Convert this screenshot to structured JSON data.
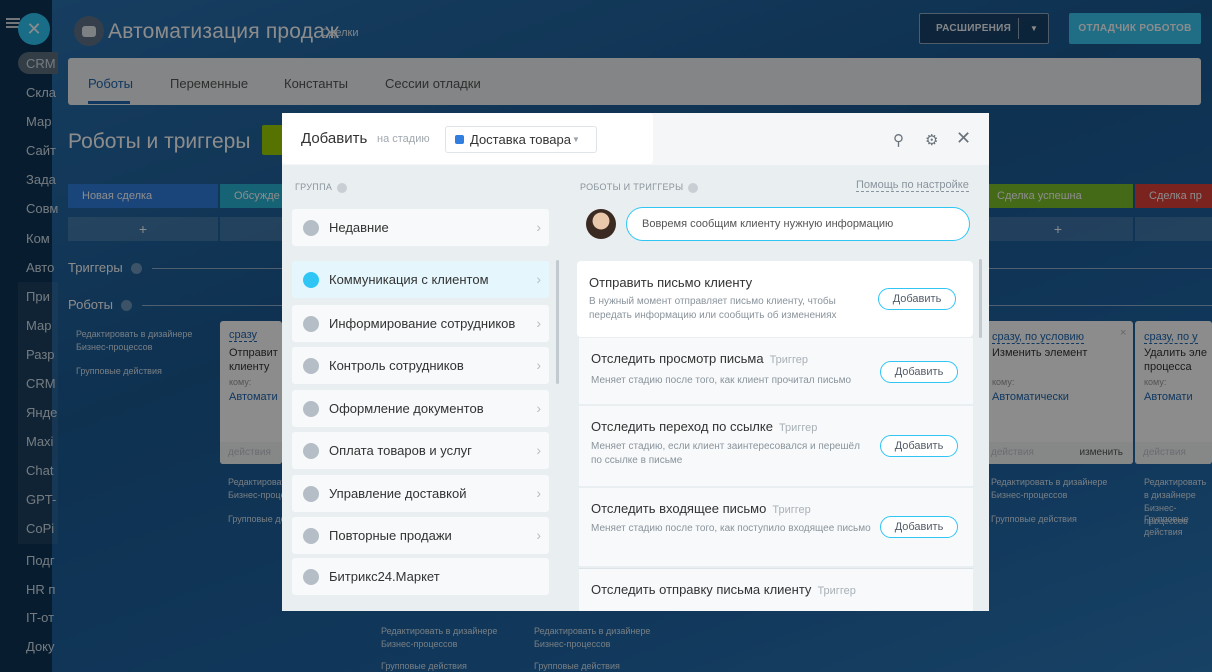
{
  "left_nav": {
    "items": [
      "CRM",
      "Скла",
      "Мар",
      "Сайт",
      "Зада",
      "Совм",
      "Ком",
      "Авто",
      "При",
      "Мар",
      "Разр",
      "CRM",
      "Янде",
      "Maxi",
      "Chat",
      "GPT-",
      "CoPi",
      "Подг",
      "HR п",
      "IT-от",
      "Доку"
    ]
  },
  "header": {
    "title": "Автоматизация продаж",
    "subtitle": "Сделки",
    "ext_button": "РАСШИРЕНИЯ",
    "debug_button": "ОТЛАДЧИК РОБОТОВ"
  },
  "tabs": [
    "Роботы",
    "Переменные",
    "Константы",
    "Сессии отладки"
  ],
  "page": {
    "title": "Роботы и триггеры",
    "triggers_label": "Триггеры",
    "robots_label": "Роботы",
    "stages": [
      "Новая сделка",
      "Обсужде",
      "Сделка успешна",
      "Сделка пр"
    ],
    "edit_link_1": "Редактировать в дизайнере",
    "edit_link_2": "Бизнес-процессов",
    "group_actions": "Групповые действия",
    "card_left": {
      "when": "сразу",
      "line1": "Отправит",
      "line2": "клиенту",
      "to": "кому:",
      "auto": "Автомати",
      "foot": "действия"
    },
    "card_r1": {
      "when": "сразу, по условию",
      "title": "Изменить элемент",
      "to": "кому:",
      "auto": "Автоматически",
      "foot": "действия",
      "edit": "изменить"
    },
    "card_r2": {
      "when": "сразу, по у",
      "line1": "Удалить эле",
      "line2": "процесса",
      "to": "кому:",
      "auto": "Автомати",
      "foot": "действия"
    },
    "bottom_edit": "Редактировать в дизайнере",
    "bottom_bp": "Бизнес-процессов",
    "bottom_group": "Групповые действия"
  },
  "dialog": {
    "title": "Добавить",
    "stage_prefix": "на стадию",
    "stage": "Доставка товара",
    "group_header": "ГРУППА",
    "list_header": "РОБОТЫ И ТРИГГЕРЫ",
    "help_link": "Помощь по настройке",
    "bubble": "Вовремя сообщим клиенту нужную информацию",
    "groups": [
      "Недавние",
      "Коммуникация с клиентом",
      "Информирование сотрудников",
      "Контроль сотрудников",
      "Оформление документов",
      "Оплата товаров и услуг",
      "Управление доставкой",
      "Повторные продажи",
      "Битрикс24.Маркет"
    ],
    "items": [
      {
        "title": "Отправить письмо клиенту",
        "trigger": "",
        "desc": "В нужный момент отправляет письмо клиенту, чтобы передать информацию или сообщить об изменениях"
      },
      {
        "title": "Отследить просмотр письма",
        "trigger": "Триггер",
        "desc": "Меняет стадию после того, как клиент прочитал письмо"
      },
      {
        "title": "Отследить переход по ссылке",
        "trigger": "Триггер",
        "desc": "Меняет стадию, если клиент заинтересовался и перешёл по ссылке в письме"
      },
      {
        "title": "Отследить входящее письмо",
        "trigger": "Триггер",
        "desc": "Меняет стадию после того, как поступило входящее письмо"
      },
      {
        "title": "Отследить отправку письма клиенту",
        "trigger": "Триггер",
        "desc": ""
      }
    ],
    "add_button": "Добавить"
  },
  "colors": {
    "accent": "#2fc6f6",
    "link": "#2067b0",
    "stage_blue": "#2f7ee0",
    "stage_green": "#9dcf00",
    "stage_red": "#e0413a"
  }
}
